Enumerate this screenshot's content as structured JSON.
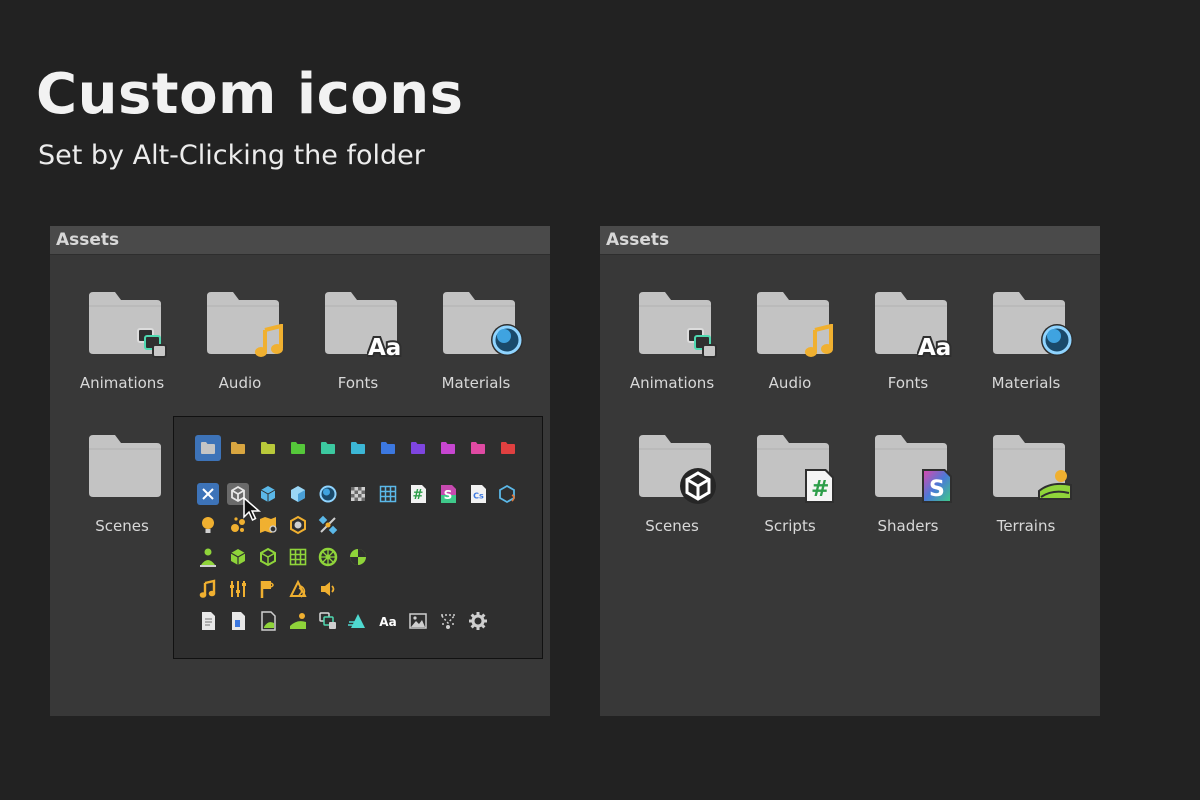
{
  "header": {
    "title": "Custom icons",
    "subtitle": "Set by Alt-Clicking the folder"
  },
  "left_panel": {
    "title": "Assets",
    "items": [
      {
        "label": "Animations",
        "icon": "animation-icon"
      },
      {
        "label": "Audio",
        "icon": "music-note-icon"
      },
      {
        "label": "Fonts",
        "icon": "font-aa-icon"
      },
      {
        "label": "Materials",
        "icon": "material-sphere-icon"
      },
      {
        "label": "Scenes",
        "icon": ""
      }
    ]
  },
  "right_panel": {
    "title": "Assets",
    "items": [
      {
        "label": "Animations",
        "icon": "animation-icon"
      },
      {
        "label": "Audio",
        "icon": "music-note-icon"
      },
      {
        "label": "Fonts",
        "icon": "font-aa-icon"
      },
      {
        "label": "Materials",
        "icon": "material-sphere-icon"
      },
      {
        "label": "Scenes",
        "icon": "unity-logo-icon"
      },
      {
        "label": "Scripts",
        "icon": "csharp-script-icon"
      },
      {
        "label": "Shaders",
        "icon": "shader-icon"
      },
      {
        "label": "Terrains",
        "icon": "terrain-icon"
      }
    ]
  },
  "icon_picker": {
    "color_swatches": [
      "#c5c5c5",
      "#d9a640",
      "#b9c93a",
      "#55c83a",
      "#3cc9a0",
      "#3cb7d6",
      "#3c78e0",
      "#7e45e0",
      "#c746d1",
      "#e04aa3",
      "#e04040"
    ],
    "selected_color": "#c5c5c5",
    "text_glyphs": {
      "script": "#",
      "shader": "S",
      "cs": "Cs",
      "font": "Aa"
    },
    "rows": [
      [
        "clear-icon",
        "prefab-icon",
        "cube-icon",
        "cube-blue-icon",
        "sphere-icon",
        "checker-icon",
        "grid-icon",
        "script-hash-icon",
        "shader-icon",
        "cs-file-icon",
        "package-icon"
      ],
      [
        "light-bulb-icon",
        "particles-icon",
        "nav-map-icon",
        "hexagon-icon",
        "satellite-icon"
      ],
      [
        "character-icon",
        "green-cube-icon",
        "green-cube-outline-icon",
        "green-grid-icon",
        "wheel-icon",
        "physics-material-icon"
      ],
      [
        "audio-note-icon",
        "mixer-icon",
        "audio-source-icon",
        "reverb-icon",
        "speaker-icon"
      ],
      [
        "document-icon",
        "document-blue-icon",
        "image-doc-icon",
        "terrain-small-icon",
        "animation-small-icon",
        "water-icon",
        "font-small-icon",
        "image-icon",
        "vfx-icon",
        "gear-icon"
      ]
    ]
  }
}
